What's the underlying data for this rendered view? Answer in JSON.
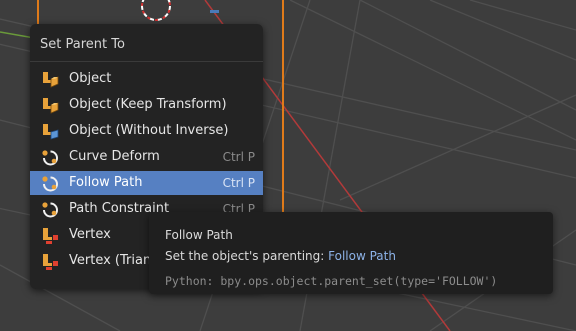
{
  "menu": {
    "title": "Set Parent To",
    "items": [
      {
        "label": "Object",
        "icon": "object-parent-icon",
        "shortcut": ""
      },
      {
        "label": "Object (Keep Transform)",
        "icon": "object-parent-icon",
        "shortcut": ""
      },
      {
        "label": "Object (Without Inverse)",
        "icon": "object-without-inverse-icon",
        "shortcut": ""
      },
      {
        "label": "Curve Deform",
        "icon": "curve-modifier-icon",
        "shortcut": "Ctrl P"
      },
      {
        "label": "Follow Path",
        "icon": "curve-modifier-icon",
        "shortcut": "Ctrl P",
        "active": true
      },
      {
        "label": "Path Constraint",
        "icon": "curve-modifier-icon",
        "shortcut": "Ctrl P"
      },
      {
        "label": "Vertex",
        "icon": "vertex-parent-icon",
        "shortcut": ""
      },
      {
        "label": "Vertex (Triangle)",
        "icon": "vertex-parent-icon",
        "shortcut": ""
      }
    ]
  },
  "tooltip": {
    "title": "Follow Path",
    "desc_prefix": "Set the object's parenting: ",
    "desc_value": "Follow Path",
    "python": "Python: bpy.ops.object.parent_set(type='FOLLOW')"
  },
  "colors": {
    "viewport_bg": "#3d3d3d",
    "menu_bg": "#232323",
    "active_item": "#5680c2",
    "tooltip_highlight": "#8db3e8",
    "x_axis": "#b23a3a",
    "y_axis": "#6a9a3a"
  }
}
